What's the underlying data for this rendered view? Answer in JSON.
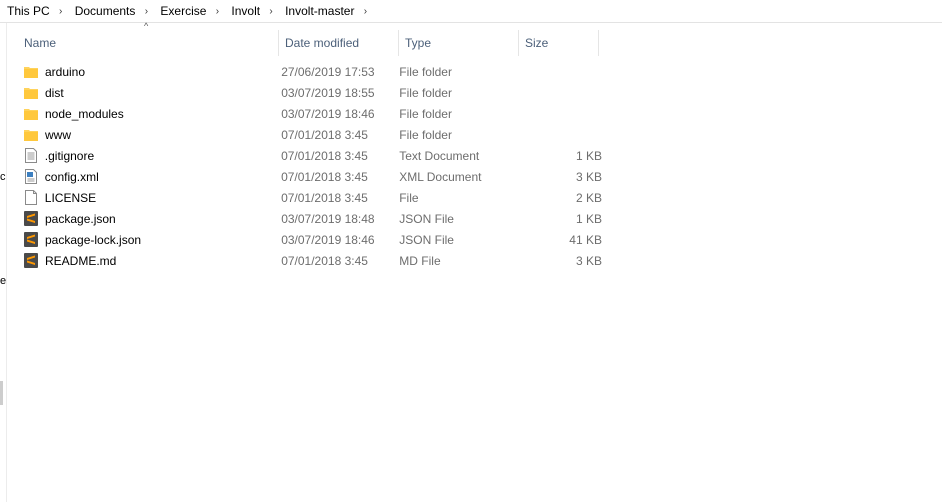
{
  "breadcrumb": [
    {
      "label": "This PC"
    },
    {
      "label": "Documents"
    },
    {
      "label": "Exercise"
    },
    {
      "label": "Involt"
    },
    {
      "label": "Involt-master"
    }
  ],
  "nav_pane": {
    "fragments": [
      "c",
      "e"
    ]
  },
  "columns": {
    "name": "Name",
    "date": "Date modified",
    "type": "Type",
    "size": "Size",
    "sort_indicator": "^"
  },
  "files": [
    {
      "name": "arduino",
      "date": "27/06/2019 17:53",
      "type": "File folder",
      "size": "",
      "icon": "folder-icon"
    },
    {
      "name": "dist",
      "date": "03/07/2019 18:55",
      "type": "File folder",
      "size": "",
      "icon": "folder-icon"
    },
    {
      "name": "node_modules",
      "date": "03/07/2019 18:46",
      "type": "File folder",
      "size": "",
      "icon": "folder-icon"
    },
    {
      "name": "www",
      "date": "07/01/2018 3:45",
      "type": "File folder",
      "size": "",
      "icon": "folder-icon"
    },
    {
      "name": ".gitignore",
      "date": "07/01/2018 3:45",
      "type": "Text Document",
      "size": "1 KB",
      "icon": "text-document-icon"
    },
    {
      "name": "config.xml",
      "date": "07/01/2018 3:45",
      "type": "XML Document",
      "size": "3 KB",
      "icon": "xml-document-icon"
    },
    {
      "name": "LICENSE",
      "date": "07/01/2018 3:45",
      "type": "File",
      "size": "2 KB",
      "icon": "blank-file-icon"
    },
    {
      "name": "package.json",
      "date": "03/07/2019 18:48",
      "type": "JSON File",
      "size": "1 KB",
      "icon": "sublime-text-icon"
    },
    {
      "name": "package-lock.json",
      "date": "03/07/2019 18:46",
      "type": "JSON File",
      "size": "41 KB",
      "icon": "sublime-text-icon"
    },
    {
      "name": "README.md",
      "date": "07/01/2018 3:45",
      "type": "MD File",
      "size": "3 KB",
      "icon": "sublime-text-icon"
    }
  ],
  "colors": {
    "folder": "#ffd35c",
    "header_text": "#4c607a",
    "secondary_text": "#6d6d6d",
    "sublime_bg": "#4a4a4a",
    "sublime_mark": "#ff9800"
  }
}
